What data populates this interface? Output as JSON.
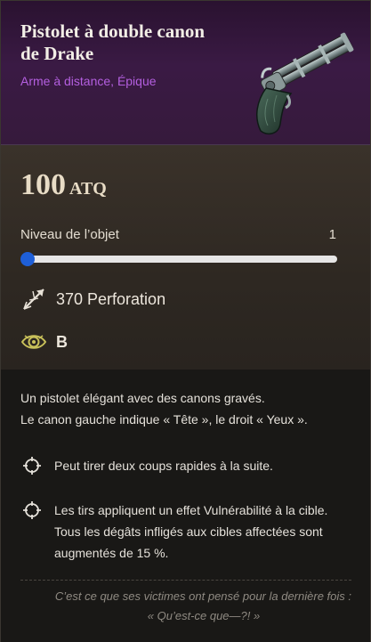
{
  "item": {
    "name": "Pistolet à double canon de Drake",
    "subtitle": "Arme à distance, Épique",
    "image_icon": "double-barrel-pistol-icon"
  },
  "stats": {
    "attack_value": "100",
    "attack_unit": "ATQ",
    "level_label": "Niveau de l’objet",
    "level_value": "1",
    "level_fraction": 0,
    "perks": [
      {
        "icon": "arrow-pierce-icon",
        "text": "370 Perforation"
      },
      {
        "icon": "eye-icon",
        "text": "B"
      }
    ]
  },
  "description": {
    "line1": "Un pistolet élégant avec des canons gravés.",
    "line2": "Le canon gauche indique « Tête », le droit « Yeux ».",
    "bullets": [
      "Peut tirer deux coups rapides à la suite.",
      "Les tirs appliquent un effet Vulnérabilité à la cible. Tous les dégâts infligés aux cibles affectées sont augmentés de 15 %."
    ],
    "quote_line1": "C’est ce que ses victimes ont pensé pour la dernière fois :",
    "quote_line2": "« Qu’est-ce que—?! »"
  },
  "colors": {
    "rarity": "#b45fe0",
    "slider_accent": "#1e5fd8"
  }
}
